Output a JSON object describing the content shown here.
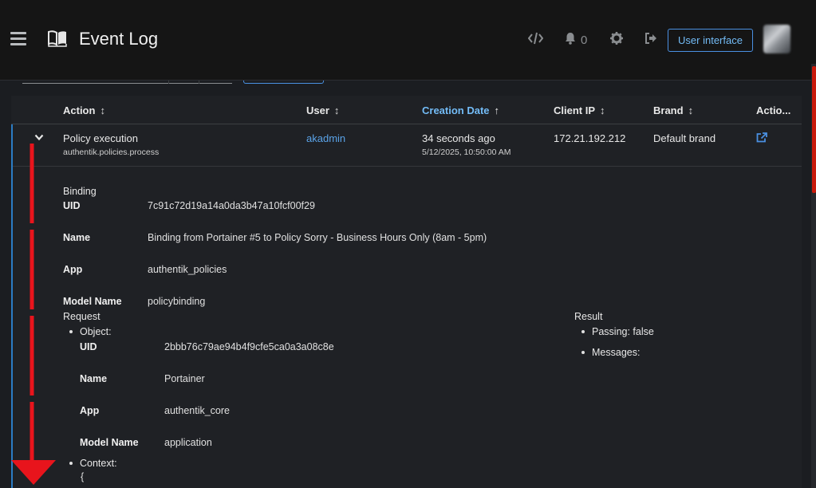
{
  "header": {
    "title": "Event Log",
    "notification_count": "0",
    "user_interface_label": "User interface"
  },
  "table": {
    "columns": [
      {
        "label": "Action",
        "sort": "↕"
      },
      {
        "label": "User",
        "sort": "↕"
      },
      {
        "label": "Creation Date",
        "sort": "↑",
        "active": true
      },
      {
        "label": "Client IP",
        "sort": "↕"
      },
      {
        "label": "Brand",
        "sort": "↕"
      },
      {
        "label": "Actio..."
      }
    ],
    "row": {
      "action": "Policy execution",
      "action_sub": "authentik.policies.process",
      "user": "akadmin",
      "date_relative": "34 seconds ago",
      "date_absolute": "5/12/2025, 10:50:00 AM",
      "client_ip": "172.21.192.212",
      "brand": "Default brand"
    }
  },
  "details": {
    "binding": {
      "heading": "Binding",
      "uid_label": "UID",
      "uid": "7c91c72d19a14a0da3b47a10fcf00f29",
      "name_label": "Name",
      "name": "Binding from Portainer #5 to Policy Sorry - Business Hours Only (8am - 5pm)",
      "app_label": "App",
      "app": "authentik_policies",
      "model_label": "Model Name",
      "model": "policybinding"
    },
    "request": {
      "heading": "Request",
      "object_label": "Object:",
      "uid_label": "UID",
      "uid": "2bbb76c79ae94b4f9cfe5ca0a3a08c8e",
      "name_label": "Name",
      "name": "Portainer",
      "app_label": "App",
      "app": "authentik_core",
      "model_label": "Model Name",
      "model": "application",
      "context_label": "Context:",
      "context_open": "{"
    },
    "result": {
      "heading": "Result",
      "passing": "Passing: false",
      "messages": "Messages:"
    }
  },
  "colors": {
    "accent_blue": "#73bcf7",
    "link_blue": "#5aa3e8",
    "annotation_red": "#e8141c"
  }
}
